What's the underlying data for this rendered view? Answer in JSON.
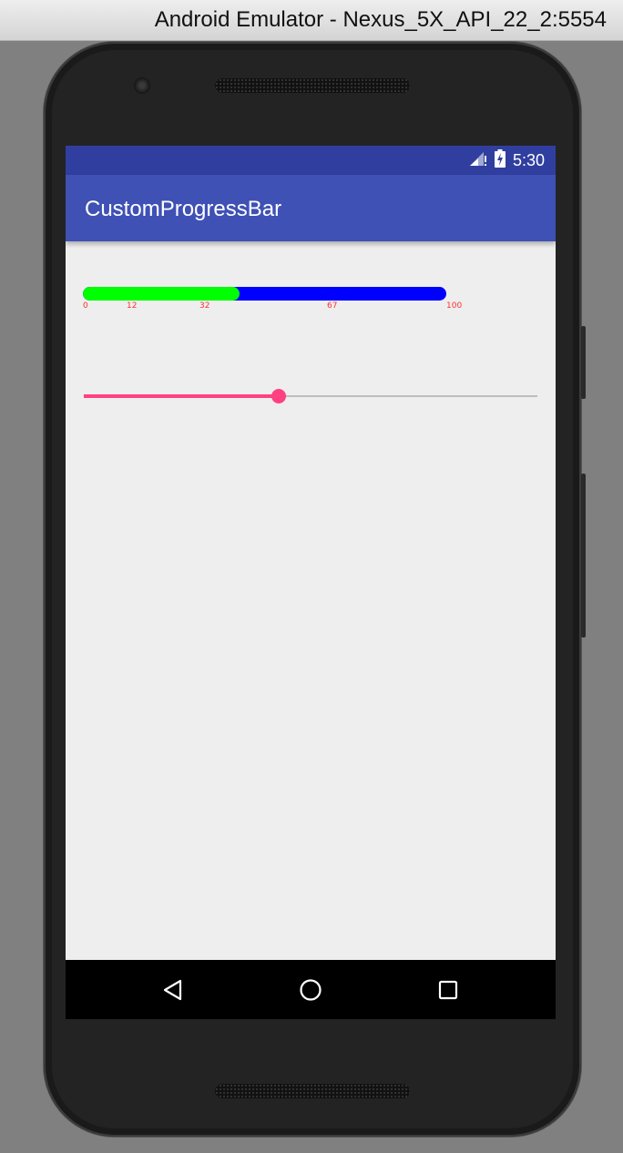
{
  "window": {
    "title": "Android Emulator - Nexus_5X_API_22_2:5554"
  },
  "status_bar": {
    "time": "5:30",
    "icons": [
      "signal-icon",
      "battery-charging-icon"
    ]
  },
  "app_bar": {
    "title": "CustomProgressBar"
  },
  "progress_bar": {
    "progress_percent": 43,
    "progress_color": "#00ff00",
    "track_color": "#0000ff",
    "tick_labels": [
      "0",
      "12",
      "32",
      "67",
      "100"
    ],
    "tick_color": "#ff3030"
  },
  "seek_bar": {
    "value_percent": 43,
    "accent_color": "#ff4081"
  },
  "nav_bar": {
    "buttons": [
      "back-icon",
      "home-icon",
      "recents-icon"
    ]
  }
}
